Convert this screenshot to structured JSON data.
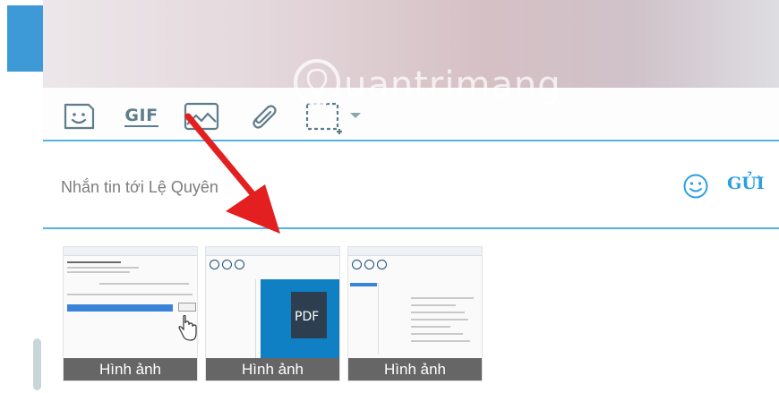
{
  "watermark": {
    "text": "uantrimang"
  },
  "composer": {
    "placeholder": "Nhắn tin tới Lệ Quyên",
    "send_label": "GỬI",
    "gif_label": "GIF"
  },
  "toolbar_icons": [
    "sticker-icon",
    "gif-icon",
    "image-icon",
    "paperclip-icon",
    "screenshot-crop-icon",
    "chevron-down-icon"
  ],
  "attachments": [
    {
      "caption": "Hình ảnh"
    },
    {
      "caption": "Hình ảnh",
      "pdf_label": "PDF"
    },
    {
      "caption": "Hình ảnh"
    }
  ],
  "colors": {
    "accent_blue": "#53b2e7",
    "send_blue": "#2b9fe0",
    "arrow_red": "#e41f1f",
    "sidebar_blue": "#3e9ad7"
  }
}
